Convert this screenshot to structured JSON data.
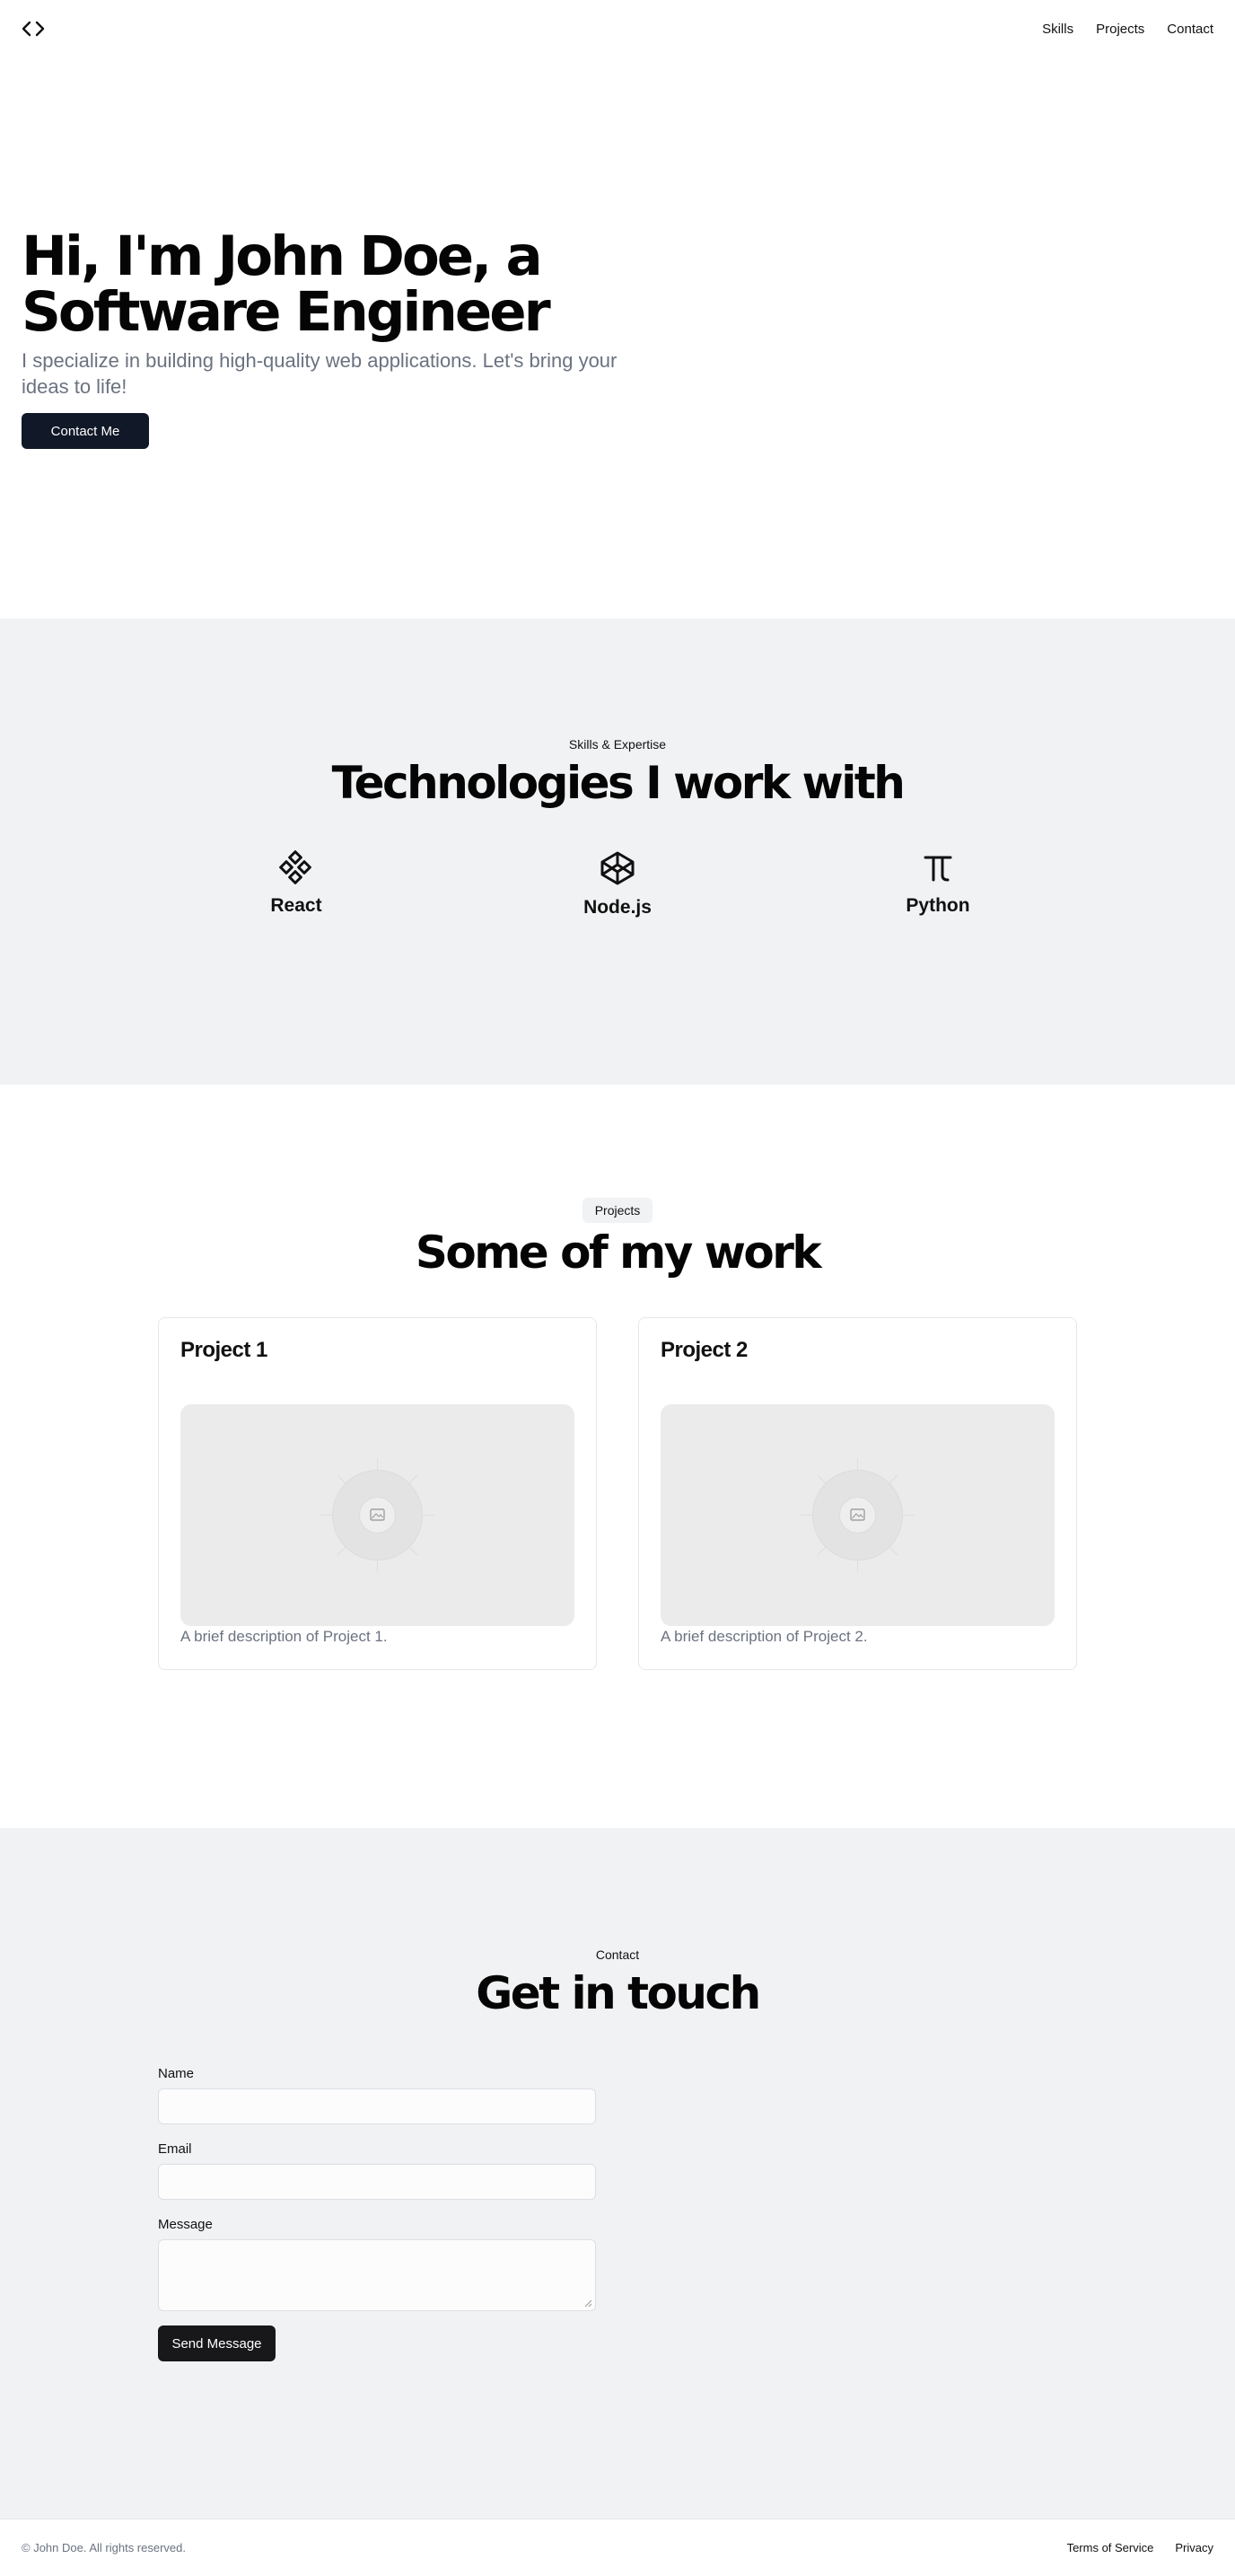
{
  "header": {
    "logo_icon": "code-brackets-icon",
    "nav": [
      {
        "label": "Skills"
      },
      {
        "label": "Projects"
      },
      {
        "label": "Contact"
      }
    ]
  },
  "hero": {
    "title_line1": "Hi, I'm John Doe, a",
    "title_line2": "Software Engineer",
    "subtitle": "I specialize in building high-quality web applications. Let's bring your ideas to life!",
    "cta_label": "Contact Me"
  },
  "skills": {
    "kicker": "Skills & Expertise",
    "title": "Technologies I work with",
    "items": [
      {
        "name": "React",
        "icon": "component-icon"
      },
      {
        "name": "Node.js",
        "icon": "codepen-icon"
      },
      {
        "name": "Python",
        "icon": "pi-icon"
      }
    ]
  },
  "projects": {
    "badge": "Projects",
    "title": "Some of my work",
    "items": [
      {
        "title": "Project 1",
        "description": "A brief description of Project 1.",
        "image_icon": "image-placeholder-icon"
      },
      {
        "title": "Project 2",
        "description": "A brief description of Project 2.",
        "image_icon": "image-placeholder-icon"
      }
    ]
  },
  "contact": {
    "kicker": "Contact",
    "title": "Get in touch",
    "fields": {
      "name_label": "Name",
      "name_value": "",
      "email_label": "Email",
      "email_value": "",
      "message_label": "Message",
      "message_value": ""
    },
    "submit_label": "Send Message"
  },
  "footer": {
    "copyright": "© John Doe. All rights reserved.",
    "links": [
      {
        "label": "Terms of Service"
      },
      {
        "label": "Privacy"
      }
    ]
  },
  "colors": {
    "primary_button": "#111827",
    "send_button": "#18181b",
    "section_gray": "#f1f2f4",
    "muted_text": "#6b7280"
  }
}
